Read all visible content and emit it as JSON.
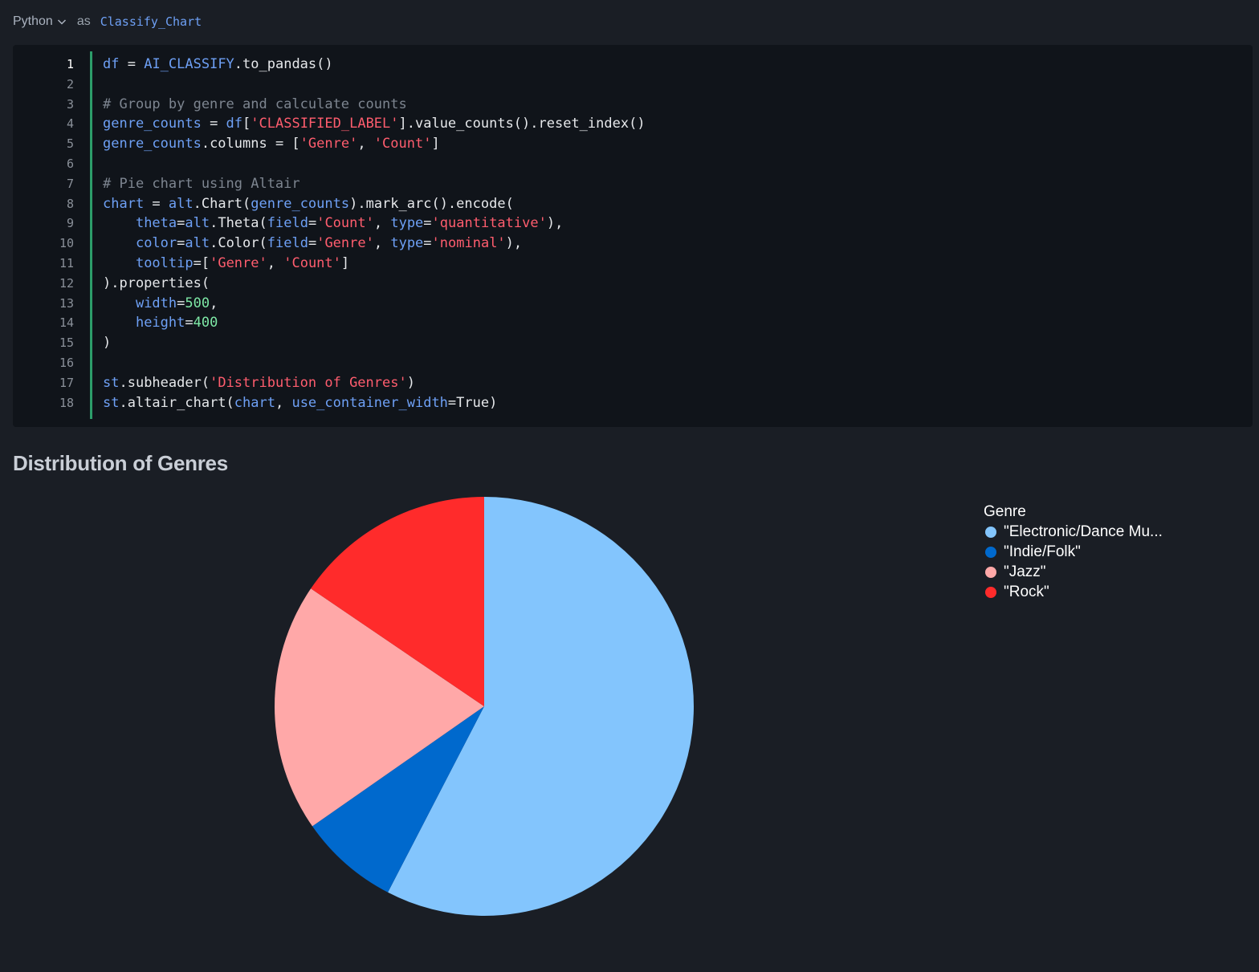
{
  "cell": {
    "language": "Python",
    "as_label": "as",
    "name": "Classify_Chart"
  },
  "code": {
    "active_line": 1,
    "lines": [
      [
        [
          "t-var",
          "df"
        ],
        [
          "t-plain",
          " = "
        ],
        [
          "t-var",
          "AI_CLASSIFY"
        ],
        [
          "t-plain",
          ".to_pandas()"
        ]
      ],
      [],
      [
        [
          "t-com",
          "# Group by genre and calculate counts"
        ]
      ],
      [
        [
          "t-var",
          "genre_counts"
        ],
        [
          "t-plain",
          " = "
        ],
        [
          "t-var",
          "df"
        ],
        [
          "t-plain",
          "["
        ],
        [
          "t-str",
          "'CLASSIFIED_LABEL'"
        ],
        [
          "t-plain",
          "].value_counts().reset_index()"
        ]
      ],
      [
        [
          "t-var",
          "genre_counts"
        ],
        [
          "t-plain",
          ".columns = ["
        ],
        [
          "t-str",
          "'Genre'"
        ],
        [
          "t-plain",
          ", "
        ],
        [
          "t-str",
          "'Count'"
        ],
        [
          "t-plain",
          "]"
        ]
      ],
      [],
      [
        [
          "t-com",
          "# Pie chart using Altair"
        ]
      ],
      [
        [
          "t-var",
          "chart"
        ],
        [
          "t-plain",
          " = "
        ],
        [
          "t-var",
          "alt"
        ],
        [
          "t-plain",
          ".Chart("
        ],
        [
          "t-var",
          "genre_counts"
        ],
        [
          "t-plain",
          ").mark_arc().encode("
        ]
      ],
      [
        [
          "t-plain",
          "    "
        ],
        [
          "t-var",
          "theta"
        ],
        [
          "t-plain",
          "="
        ],
        [
          "t-var",
          "alt"
        ],
        [
          "t-plain",
          ".Theta("
        ],
        [
          "t-var",
          "field"
        ],
        [
          "t-plain",
          "="
        ],
        [
          "t-str",
          "'Count'"
        ],
        [
          "t-plain",
          ", "
        ],
        [
          "t-var",
          "type"
        ],
        [
          "t-plain",
          "="
        ],
        [
          "t-str",
          "'quantitative'"
        ],
        [
          "t-plain",
          "),"
        ]
      ],
      [
        [
          "t-plain",
          "    "
        ],
        [
          "t-var",
          "color"
        ],
        [
          "t-plain",
          "="
        ],
        [
          "t-var",
          "alt"
        ],
        [
          "t-plain",
          ".Color("
        ],
        [
          "t-var",
          "field"
        ],
        [
          "t-plain",
          "="
        ],
        [
          "t-str",
          "'Genre'"
        ],
        [
          "t-plain",
          ", "
        ],
        [
          "t-var",
          "type"
        ],
        [
          "t-plain",
          "="
        ],
        [
          "t-str",
          "'nominal'"
        ],
        [
          "t-plain",
          "),"
        ]
      ],
      [
        [
          "t-plain",
          "    "
        ],
        [
          "t-var",
          "tooltip"
        ],
        [
          "t-plain",
          "=["
        ],
        [
          "t-str",
          "'Genre'"
        ],
        [
          "t-plain",
          ", "
        ],
        [
          "t-str",
          "'Count'"
        ],
        [
          "t-plain",
          "]"
        ]
      ],
      [
        [
          "t-plain",
          ").properties("
        ]
      ],
      [
        [
          "t-plain",
          "    "
        ],
        [
          "t-var",
          "width"
        ],
        [
          "t-plain",
          "="
        ],
        [
          "t-num",
          "500"
        ],
        [
          "t-plain",
          ","
        ]
      ],
      [
        [
          "t-plain",
          "    "
        ],
        [
          "t-var",
          "height"
        ],
        [
          "t-plain",
          "="
        ],
        [
          "t-num",
          "400"
        ]
      ],
      [
        [
          "t-plain",
          ")"
        ]
      ],
      [],
      [
        [
          "t-var",
          "st"
        ],
        [
          "t-plain",
          ".subheader("
        ],
        [
          "t-str",
          "'Distribution of Genres'"
        ],
        [
          "t-plain",
          ")"
        ]
      ],
      [
        [
          "t-var",
          "st"
        ],
        [
          "t-plain",
          ".altair_chart("
        ],
        [
          "t-var",
          "chart"
        ],
        [
          "t-plain",
          ", "
        ],
        [
          "t-var",
          "use_container_width"
        ],
        [
          "t-plain",
          "=True)"
        ]
      ]
    ]
  },
  "output": {
    "subheader": "Distribution of Genres"
  },
  "chart_data": {
    "type": "pie",
    "legend_title": "Genre",
    "legend_position": "top-right",
    "categories": [
      "\"Electronic/Dance Mu...",
      "\"Indie/Folk\"",
      "\"Jazz\"",
      "\"Rock\""
    ],
    "values": [
      57.6,
      7.7,
      19.2,
      15.5
    ],
    "colors": [
      "#83c5fd",
      "#0069cd",
      "#ffa8a8",
      "#ff2b2b"
    ]
  }
}
